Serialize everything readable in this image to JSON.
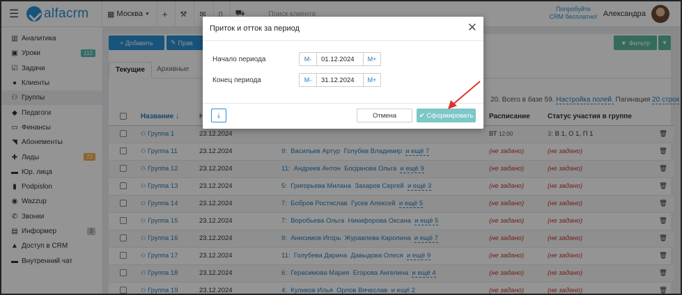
{
  "topbar": {
    "logo_text": "alfacrm",
    "branch": "Москва",
    "search_placeholder": "Поиск клиента",
    "promo_line1": "Попробуйте",
    "promo_line2": "CRM бесплатно!",
    "user_name": "Александра"
  },
  "sidebar": {
    "items": [
      {
        "label": "Аналитика",
        "icon": "chart-icon"
      },
      {
        "label": "Уроки",
        "icon": "calendar-icon",
        "badge": "112"
      },
      {
        "label": "Задачи",
        "icon": "tasks-icon"
      },
      {
        "label": "Клиенты",
        "icon": "user-icon"
      },
      {
        "label": "Группы",
        "icon": "users-icon"
      },
      {
        "label": "Педагоги",
        "icon": "graduation-cap-icon"
      },
      {
        "label": "Финансы",
        "icon": "money-icon"
      },
      {
        "label": "Абонементы",
        "icon": "tag-icon"
      },
      {
        "label": "Лиды",
        "icon": "user-plus-icon",
        "badge": "23"
      },
      {
        "label": "Юр. лица",
        "icon": "briefcase-icon"
      },
      {
        "label": "Podpislon",
        "icon": "document-icon"
      },
      {
        "label": "Wazzup",
        "icon": "whatsapp-icon"
      },
      {
        "label": "Звонки",
        "icon": "phone-icon"
      },
      {
        "label": "Информер",
        "icon": "info-icon",
        "badge": "3"
      },
      {
        "label": "Доступ в CRM",
        "icon": "lock-icon"
      },
      {
        "label": "Внутренний чат",
        "icon": "chat-icon"
      }
    ]
  },
  "toolbar": {
    "add_label": "+ Добавить",
    "edit_label": "Прав",
    "filter_label": "Фильтр"
  },
  "tabs": {
    "current": "Текущие",
    "archive": "Архивные"
  },
  "pager": {
    "text": "20. Всего в базе 59.",
    "settings_link": "Настройка полей.",
    "pagination_label": "Пагинация",
    "pagination_link": "20 строк"
  },
  "table": {
    "headers": {
      "name": "Название ↓",
      "date": "Н",
      "schedule": "Расписание",
      "status": "Статус участия в группе"
    },
    "rows": [
      {
        "name": "Группа 1",
        "date": "23.12.2024",
        "count": "",
        "s1": "",
        "s2": "",
        "more": "",
        "schedule": "ВТ",
        "schedule_time": "12:00",
        "status_count": "3:",
        "status": "В 1, О 1, П 1"
      },
      {
        "name": "Группа 11",
        "date": "23.12.2024",
        "count": "9:",
        "s1": "Васильев Артур",
        "s2": "Голубев Владимир",
        "more": "и ещё 7",
        "schedule": "(не задано)",
        "schedule_time": "",
        "status_count": "",
        "status": "(не задано)"
      },
      {
        "name": "Группа 12",
        "date": "23.12.2024",
        "count": "11:",
        "s1": "Андреев Антон",
        "s2": "Богданова Ольга",
        "more": "и ещё 9",
        "schedule": "(не задано)",
        "schedule_time": "",
        "status_count": "",
        "status": "(не задано)"
      },
      {
        "name": "Группа 13",
        "date": "23.12.2024",
        "count": "5:",
        "s1": "Григорьева Милана",
        "s2": "Захаров Сергей",
        "more": "и ещё 3",
        "schedule": "(не задано)",
        "schedule_time": "",
        "status_count": "",
        "status": "(не задано)"
      },
      {
        "name": "Группа 14",
        "date": "23.12.2024",
        "count": "7:",
        "s1": "Бобров Ростислав",
        "s2": "Гусев Алексей",
        "more": "и ещё 5",
        "schedule": "(не задано)",
        "schedule_time": "",
        "status_count": "",
        "status": "(не задано)"
      },
      {
        "name": "Группа 15",
        "date": "23.12.2024",
        "count": "7:",
        "s1": "Воробьева Ольга",
        "s2": "Никифорова Оксана",
        "more": "и ещё 5",
        "schedule": "(не задано)",
        "schedule_time": "",
        "status_count": "",
        "status": "(не задано)"
      },
      {
        "name": "Группа 16",
        "date": "23.12.2024",
        "count": "9:",
        "s1": "Анисимов Игорь",
        "s2": "Журавлева Каролина",
        "more": "и ещё 7",
        "schedule": "(не задано)",
        "schedule_time": "",
        "status_count": "",
        "status": "(не задано)"
      },
      {
        "name": "Группа 17",
        "date": "23.12.2024",
        "count": "11:",
        "s1": "Голубева Дарина",
        "s2": "Давыдова Олеся",
        "more": "и ещё 9",
        "schedule": "(не задано)",
        "schedule_time": "",
        "status_count": "",
        "status": "(не задано)"
      },
      {
        "name": "Группа 18",
        "date": "23.12.2024",
        "count": "6:",
        "s1": "Герасимова Мария",
        "s2": "Егорова Ангелина",
        "more": "и ещё 4",
        "schedule": "(не задано)",
        "schedule_time": "",
        "status_count": "",
        "status": "(не задано)"
      },
      {
        "name": "Группа 19",
        "date": "23.12.2024",
        "count": "4:",
        "s1": "Куликов Илья",
        "s2": "Орлов Вячеслав",
        "more": "и ещё 2",
        "schedule": "(не задано)",
        "schedule_time": "",
        "status_count": "",
        "status": "(не задано)"
      }
    ]
  },
  "modal": {
    "title": "Приток и отток за период",
    "start_label": "Начало периода",
    "start_value": "01.12.2024",
    "end_label": "Конец периода",
    "end_value": "31.12.2024",
    "minus_label": "М-",
    "plus_label": "М+",
    "cancel_label": "Отмена",
    "submit_label": "✔ Сформировать"
  },
  "colors": {
    "accent": "#2a8fd4",
    "submit": "#7cc7c7",
    "annotation_arrow": "#e0322b"
  }
}
